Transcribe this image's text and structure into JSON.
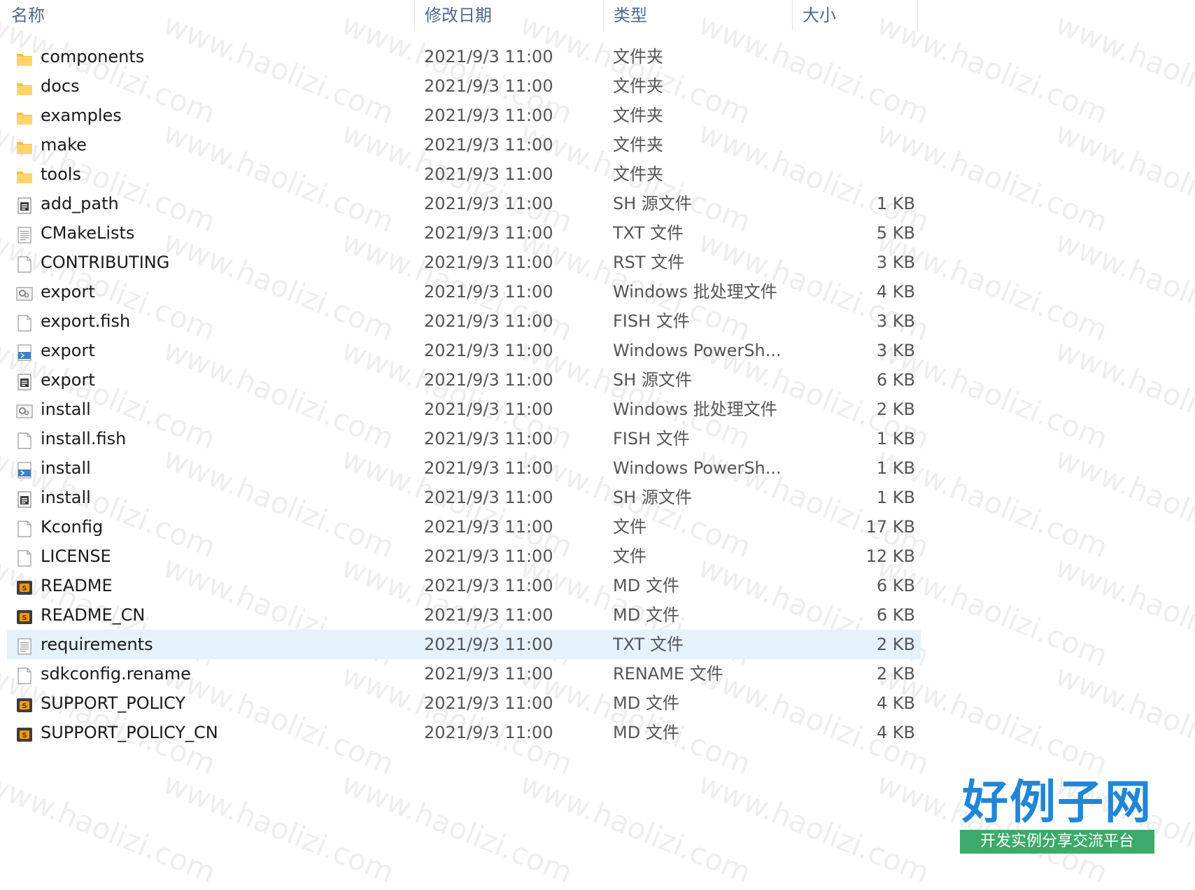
{
  "header": {
    "name_label": "名称",
    "date_label": "修改日期",
    "type_label": "类型",
    "size_label": "大小",
    "sort_arrow": "^"
  },
  "files": [
    {
      "icon": "folder-icon",
      "name": "components",
      "date": "2021/9/3 11:00",
      "type": "文件夹",
      "size": ""
    },
    {
      "icon": "folder-icon",
      "name": "docs",
      "date": "2021/9/3 11:00",
      "type": "文件夹",
      "size": ""
    },
    {
      "icon": "folder-icon",
      "name": "examples",
      "date": "2021/9/3 11:00",
      "type": "文件夹",
      "size": ""
    },
    {
      "icon": "folder-icon",
      "name": "make",
      "date": "2021/9/3 11:00",
      "type": "文件夹",
      "size": ""
    },
    {
      "icon": "folder-icon",
      "name": "tools",
      "date": "2021/9/3 11:00",
      "type": "文件夹",
      "size": ""
    },
    {
      "icon": "shell-script-icon",
      "name": "add_path",
      "date": "2021/9/3 11:00",
      "type": "SH 源文件",
      "size": "1 KB"
    },
    {
      "icon": "text-file-icon",
      "name": "CMakeLists",
      "date": "2021/9/3 11:00",
      "type": "TXT 文件",
      "size": "5 KB"
    },
    {
      "icon": "blank-file-icon",
      "name": "CONTRIBUTING",
      "date": "2021/9/3 11:00",
      "type": "RST 文件",
      "size": "3 KB"
    },
    {
      "icon": "batch-file-icon",
      "name": "export",
      "date": "2021/9/3 11:00",
      "type": "Windows 批处理文件",
      "size": "4 KB"
    },
    {
      "icon": "blank-file-icon",
      "name": "export.fish",
      "date": "2021/9/3 11:00",
      "type": "FISH 文件",
      "size": "3 KB"
    },
    {
      "icon": "powershell-icon",
      "name": "export",
      "date": "2021/9/3 11:00",
      "type": "Windows PowerSh...",
      "size": "3 KB"
    },
    {
      "icon": "shell-script-icon",
      "name": "export",
      "date": "2021/9/3 11:00",
      "type": "SH 源文件",
      "size": "6 KB"
    },
    {
      "icon": "batch-file-icon",
      "name": "install",
      "date": "2021/9/3 11:00",
      "type": "Windows 批处理文件",
      "size": "2 KB"
    },
    {
      "icon": "blank-file-icon",
      "name": "install.fish",
      "date": "2021/9/3 11:00",
      "type": "FISH 文件",
      "size": "1 KB"
    },
    {
      "icon": "powershell-icon",
      "name": "install",
      "date": "2021/9/3 11:00",
      "type": "Windows PowerSh...",
      "size": "1 KB"
    },
    {
      "icon": "shell-script-icon",
      "name": "install",
      "date": "2021/9/3 11:00",
      "type": "SH 源文件",
      "size": "1 KB"
    },
    {
      "icon": "blank-file-icon",
      "name": "Kconfig",
      "date": "2021/9/3 11:00",
      "type": "文件",
      "size": "17 KB"
    },
    {
      "icon": "blank-file-icon",
      "name": "LICENSE",
      "date": "2021/9/3 11:00",
      "type": "文件",
      "size": "12 KB"
    },
    {
      "icon": "sublime-file-icon",
      "name": "README",
      "date": "2021/9/3 11:00",
      "type": "MD 文件",
      "size": "6 KB"
    },
    {
      "icon": "sublime-file-icon",
      "name": "README_CN",
      "date": "2021/9/3 11:00",
      "type": "MD 文件",
      "size": "6 KB"
    },
    {
      "icon": "text-file-icon",
      "name": "requirements",
      "date": "2021/9/3 11:00",
      "type": "TXT 文件",
      "size": "2 KB",
      "selected": true
    },
    {
      "icon": "blank-file-icon",
      "name": "sdkconfig.rename",
      "date": "2021/9/3 11:00",
      "type": "RENAME 文件",
      "size": "2 KB"
    },
    {
      "icon": "sublime-file-icon",
      "name": "SUPPORT_POLICY",
      "date": "2021/9/3 11:00",
      "type": "MD 文件",
      "size": "4 KB"
    },
    {
      "icon": "sublime-file-icon",
      "name": "SUPPORT_POLICY_CN",
      "date": "2021/9/3 11:00",
      "type": "MD 文件",
      "size": "4 KB"
    }
  ],
  "watermark": {
    "text": "www.haolizi.com"
  },
  "logo": {
    "title": "好例子网",
    "subtitle": "开发实例分享交流平台"
  },
  "colors": {
    "header_text": "#4c6a8e",
    "selected_row": "#e5f1fb",
    "folder": "#f4c14a",
    "logo_blue": "#1f86d8",
    "logo_green": "#3da96a"
  }
}
